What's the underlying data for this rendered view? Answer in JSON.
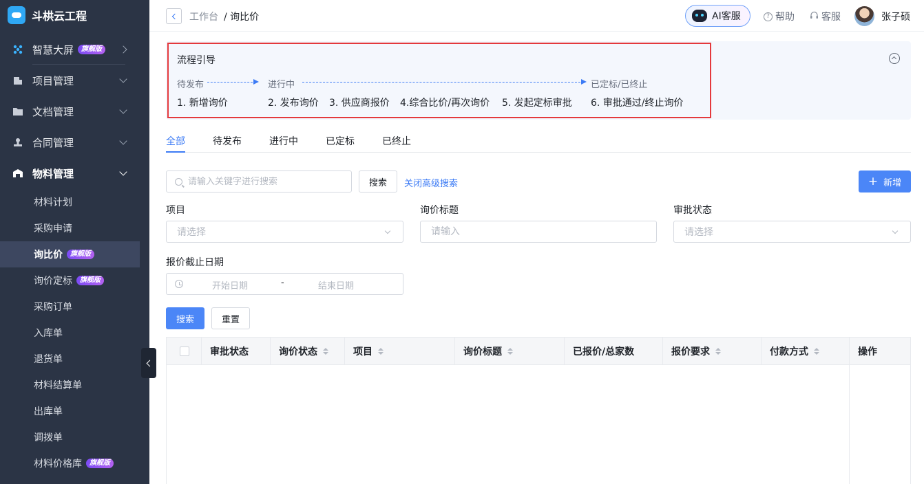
{
  "brand": {
    "name": "斗栱云工程"
  },
  "sidebar": {
    "items": [
      {
        "label": "智慧大屏",
        "badge": "旗舰版"
      },
      {
        "label": "项目管理"
      },
      {
        "label": "文档管理"
      },
      {
        "label": "合同管理"
      },
      {
        "label": "物料管理"
      }
    ],
    "sub_items": [
      {
        "label": "材料计划"
      },
      {
        "label": "采购申请"
      },
      {
        "label": "询比价",
        "badge": "旗舰版"
      },
      {
        "label": "询价定标",
        "badge": "旗舰版"
      },
      {
        "label": "采购订单"
      },
      {
        "label": "入库单"
      },
      {
        "label": "退货单"
      },
      {
        "label": "材料结算单"
      },
      {
        "label": "出库单"
      },
      {
        "label": "调拨单"
      },
      {
        "label": "材料价格库",
        "badge": "旗舰版"
      }
    ]
  },
  "header": {
    "breadcrumb_home": "工作台",
    "breadcrumb_current": "/ 询比价",
    "ai_label": "AI客服",
    "help_label": "帮助",
    "service_label": "客服",
    "user_name": "张子硕"
  },
  "guide": {
    "title": "流程引导",
    "phases": [
      "待发布",
      "进行中",
      "已定标/已终止"
    ],
    "steps": [
      "1. 新增询价",
      "2. 发布询价",
      "3. 供应商报价",
      "4.综合比价/再次询价",
      "5. 发起定标审批",
      "6. 审批通过/终止询价"
    ]
  },
  "tabs": [
    "全部",
    "待发布",
    "进行中",
    "已定标",
    "已终止"
  ],
  "search": {
    "placeholder": "请输入关键字进行搜索",
    "button": "搜索",
    "advanced_toggle": "关闭高级搜索",
    "add_button": "新增"
  },
  "filters": {
    "project_label": "项目",
    "project_placeholder": "请选择",
    "title_label": "询价标题",
    "title_placeholder": "请输入",
    "status_label": "审批状态",
    "status_placeholder": "请选择",
    "date_label": "报价截止日期",
    "date_start": "开始日期",
    "date_sep": "-",
    "date_end": "结束日期",
    "search_button": "搜索",
    "reset_button": "重置"
  },
  "table": {
    "columns": [
      "审批状态",
      "询价状态",
      "项目",
      "询价标题",
      "已报价/总家数",
      "报价要求",
      "付款方式",
      "操作"
    ]
  },
  "colors": {
    "sidebar_bg": "#2b3445",
    "accent": "#3c7bf5",
    "highlight_border": "#e4393c"
  }
}
